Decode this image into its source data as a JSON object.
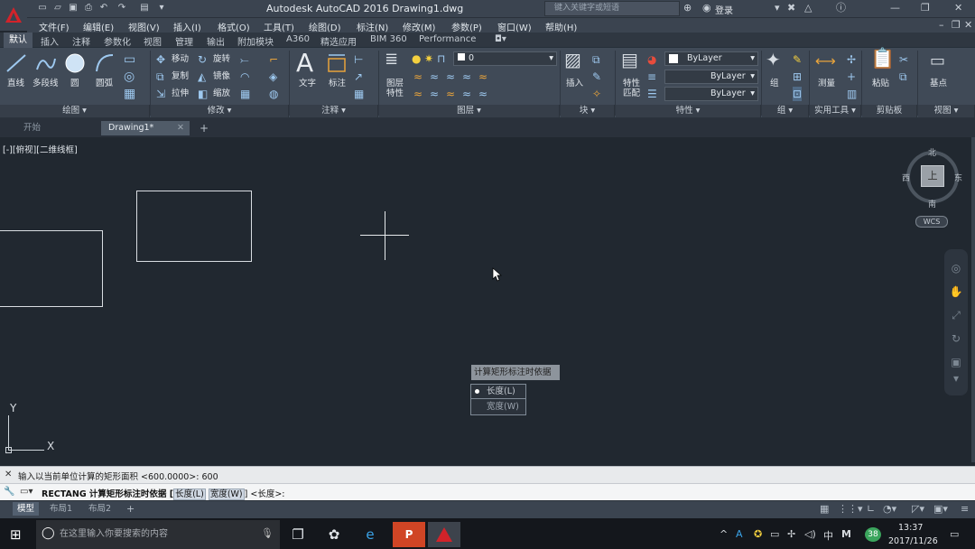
{
  "window": {
    "title": "Autodesk AutoCAD 2016    Drawing1.dwg",
    "search_placeholder": "键入关键字或短语",
    "login_label": "登录"
  },
  "menu": [
    "文件(F)",
    "编辑(E)",
    "视图(V)",
    "插入(I)",
    "格式(O)",
    "工具(T)",
    "绘图(D)",
    "标注(N)",
    "修改(M)",
    "参数(P)",
    "窗口(W)",
    "帮助(H)"
  ],
  "ribbon_tabs": [
    "默认",
    "插入",
    "注释",
    "参数化",
    "视图",
    "管理",
    "输出",
    "附加模块",
    "A360",
    "精选应用",
    "BIM 360",
    "Performance"
  ],
  "ribbon": {
    "draw": {
      "line": "直线",
      "polyline": "多段线",
      "circle": "圆",
      "arc": "圆弧",
      "footer": "绘图 ▾"
    },
    "modify": {
      "move": "移动",
      "rotate": "旋转",
      "copy": "复制",
      "mirror": "镜像",
      "stretch": "拉伸",
      "scale": "缩放",
      "footer": "修改 ▾"
    },
    "annotation": {
      "text": "文字",
      "dim": "标注",
      "footer": "注释 ▾"
    },
    "layers": {
      "props": "图层\n特性",
      "current_layer": "0",
      "footer": "图层 ▾"
    },
    "block": {
      "insert": "插入",
      "footer": "块 ▾"
    },
    "properties": {
      "match": "特性\n匹配",
      "color": "ByLayer",
      "linetype": "ByLayer",
      "lineweight": "ByLayer",
      "footer": "特性 ▾"
    },
    "groups": {
      "group": "组",
      "footer": "组 ▾"
    },
    "utilities": {
      "measure": "测量",
      "footer": "实用工具 ▾"
    },
    "clipboard": {
      "paste": "粘贴",
      "footer": "剪贴板"
    },
    "view": {
      "base": "基点",
      "footer": "视图 ▾"
    }
  },
  "file_tabs": {
    "start": "开始",
    "drawing": "Drawing1*"
  },
  "viewport_label": "[-][俯视][二维线框]",
  "viewcube": {
    "top": "上",
    "north": "北",
    "south": "南",
    "east": "东",
    "west": "西",
    "wcs": "WCS"
  },
  "ucs": {
    "x": "X",
    "y": "Y"
  },
  "dynamic_prompt": {
    "title": "计算矩形标注时依据",
    "options": [
      "长度(L)",
      "宽度(W)"
    ]
  },
  "command": {
    "history": "输入以当前单位计算的矩形面积 <600.0000>:  600",
    "prompt_prefix": "RECTANG 计算矩形标注时依据 [",
    "opt1": "长度(L)",
    "opt2": "宽度(W)",
    "prompt_suffix": "] <长度>:"
  },
  "layout_tabs": [
    "模型",
    "布局1",
    "布局2"
  ],
  "taskbar": {
    "search_placeholder": "在这里输入你要搜索的内容",
    "time": "13:37",
    "date": "2017/11/26",
    "ime_label": "中",
    "badge": "38"
  }
}
